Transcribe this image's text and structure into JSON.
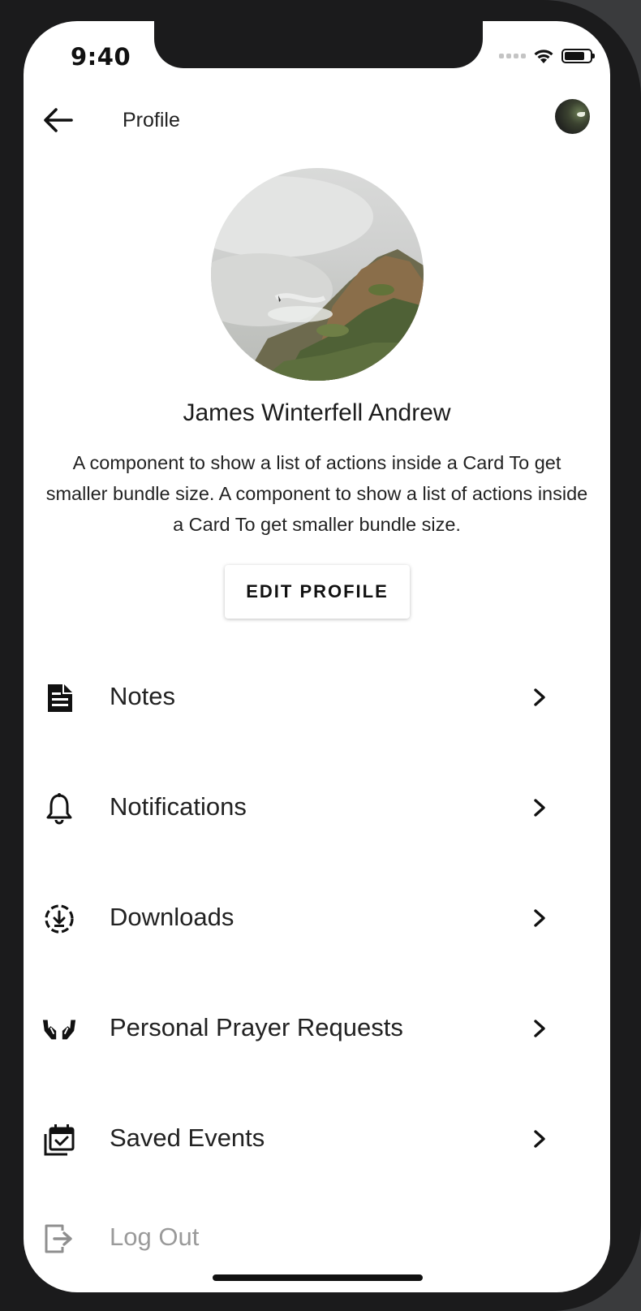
{
  "status_bar": {
    "time": "9:40"
  },
  "appbar": {
    "title": "Profile"
  },
  "profile": {
    "name": "James Winterfell Andrew",
    "bio": "A component to show a list of actions inside a Card To get smaller bundle size. A component to show a list of actions inside a Card To get smaller bundle size.",
    "edit_label": "EDIT PROFILE"
  },
  "menu": [
    {
      "label": "Notes",
      "icon": "notes-icon"
    },
    {
      "label": "Notifications",
      "icon": "bell-icon"
    },
    {
      "label": "Downloads",
      "icon": "download-icon"
    },
    {
      "label": "Personal Prayer Requests",
      "icon": "praying-hands-icon"
    },
    {
      "label": "Saved Events",
      "icon": "calendar-check-icon"
    },
    {
      "label": "Log Out",
      "icon": "logout-icon"
    }
  ]
}
